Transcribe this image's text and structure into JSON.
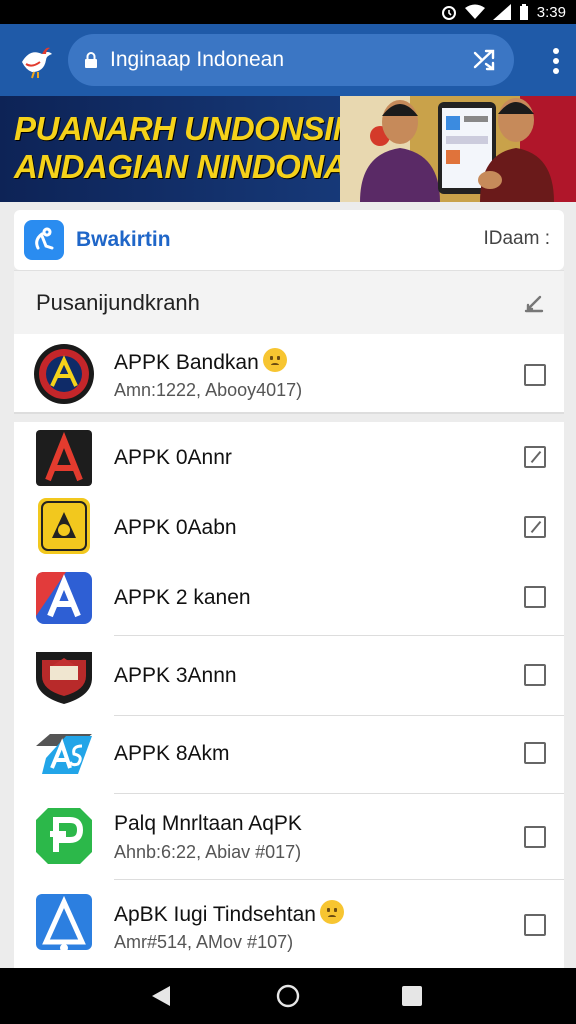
{
  "status": {
    "time": "3:39"
  },
  "browser": {
    "url": "Inginaap Indonean"
  },
  "banner": {
    "line1": "PUANARH UNDONSIM",
    "line2": "ANDAGIAN NINDONASIA"
  },
  "app": {
    "title": "Bwakirtin",
    "right_label": "IDaam :"
  },
  "section": {
    "title": "Pusanijundkranh"
  },
  "rows": [
    {
      "name": "APPK Bandkan",
      "sub": "Amn:1222, Abooy4017)",
      "checked": false,
      "emoji": true
    },
    {
      "name": "APPK 0Annr",
      "checked": true
    },
    {
      "name": "APPK 0Aabn",
      "checked": true
    },
    {
      "name": "APPK 2 kanen",
      "checked": false
    },
    {
      "name": "APPK 3Annn",
      "checked": false
    },
    {
      "name": "APPK 8Akm",
      "checked": false
    },
    {
      "name": "Palq Mnrltaan AqPK",
      "sub": "Ahnb:6:22, Abiav #017)",
      "checked": false
    },
    {
      "name": "ApBK Iugi Tindsehtan",
      "sub": "Amr#514, AMov #107)",
      "checked": false,
      "emoji": true
    }
  ],
  "colors": {
    "toolbar": "#1f5aa8",
    "accent": "#1f66c8",
    "banner_text": "#f5d21a"
  }
}
